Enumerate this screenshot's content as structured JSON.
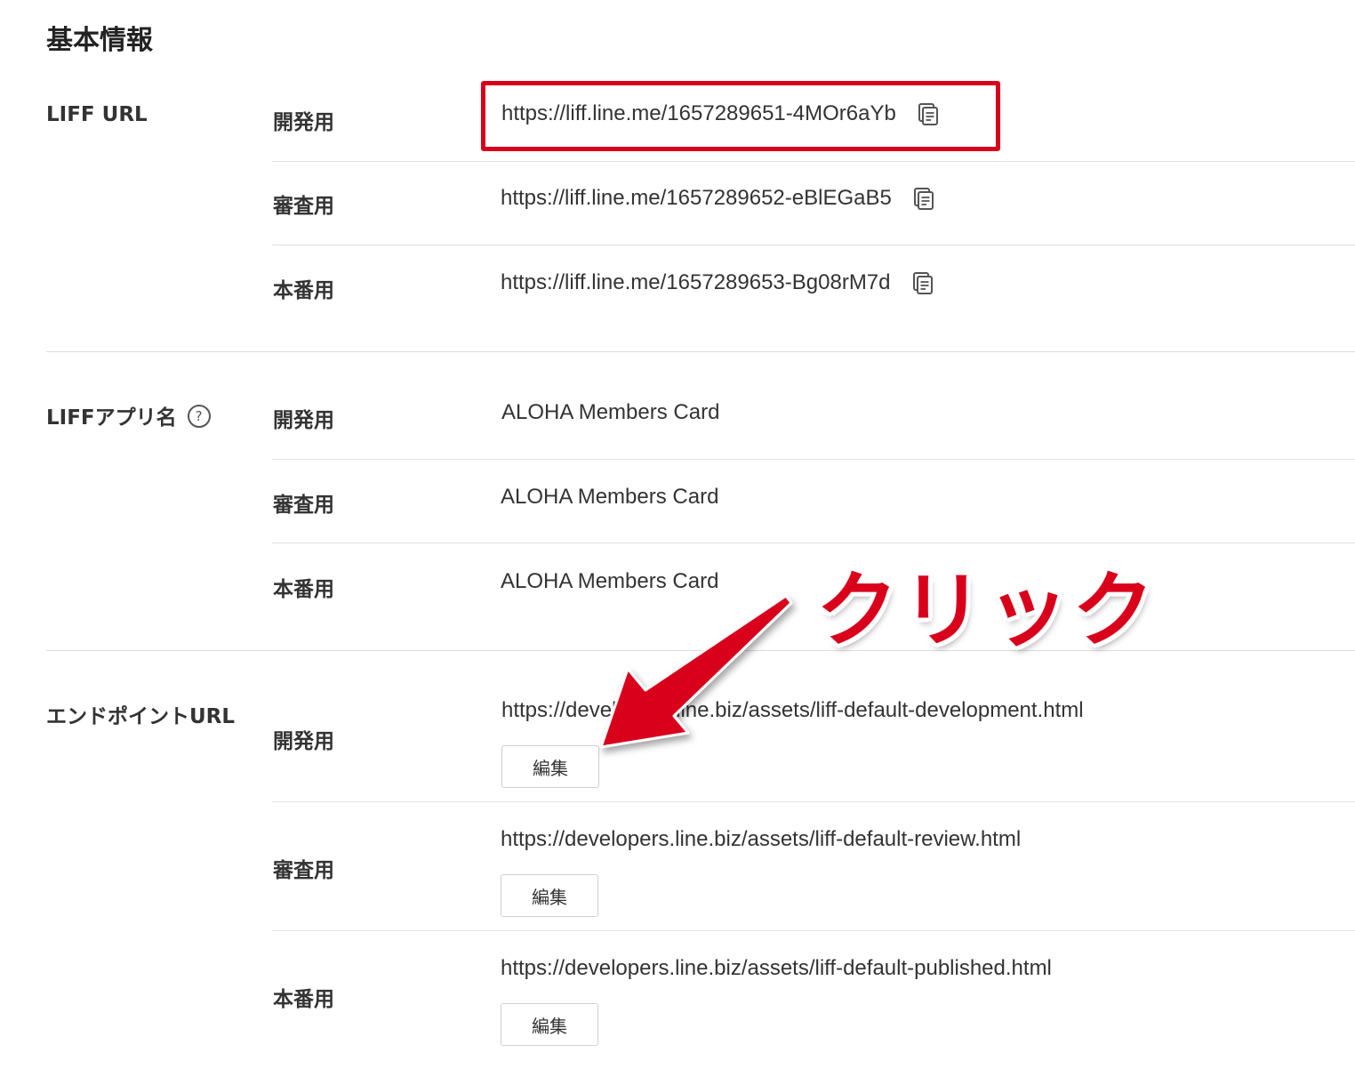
{
  "heading": "基本情報",
  "liff_url": {
    "label": "LIFF URL",
    "rows": [
      {
        "label": "開発用",
        "value": "https://liff.line.me/1657289651-4MOr6aYb"
      },
      {
        "label": "審査用",
        "value": "https://liff.line.me/1657289652-eBlEGaB5"
      },
      {
        "label": "本番用",
        "value": "https://liff.line.me/1657289653-Bg08rM7d"
      }
    ]
  },
  "liff_app_name": {
    "label": "LIFFアプリ名",
    "help_icon": "?",
    "rows": [
      {
        "label": "開発用",
        "value": "ALOHA Members Card"
      },
      {
        "label": "審査用",
        "value": "ALOHA Members Card"
      },
      {
        "label": "本番用",
        "value": "ALOHA Members Card"
      }
    ]
  },
  "endpoint_url": {
    "label": "エンドポイントURL",
    "rows": [
      {
        "label": "開発用",
        "value": "https://developers.line.biz/assets/liff-default-development.html",
        "button": "編集"
      },
      {
        "label": "審査用",
        "value": "https://developers.line.biz/assets/liff-default-review.html",
        "button": "編集"
      },
      {
        "label": "本番用",
        "value": "https://developers.line.biz/assets/liff-default-published.html",
        "button": "編集"
      }
    ]
  },
  "annotation": {
    "text": "クリック",
    "color": "#d9001b"
  },
  "icons": {
    "copy": "copy-icon",
    "help": "help-icon"
  }
}
